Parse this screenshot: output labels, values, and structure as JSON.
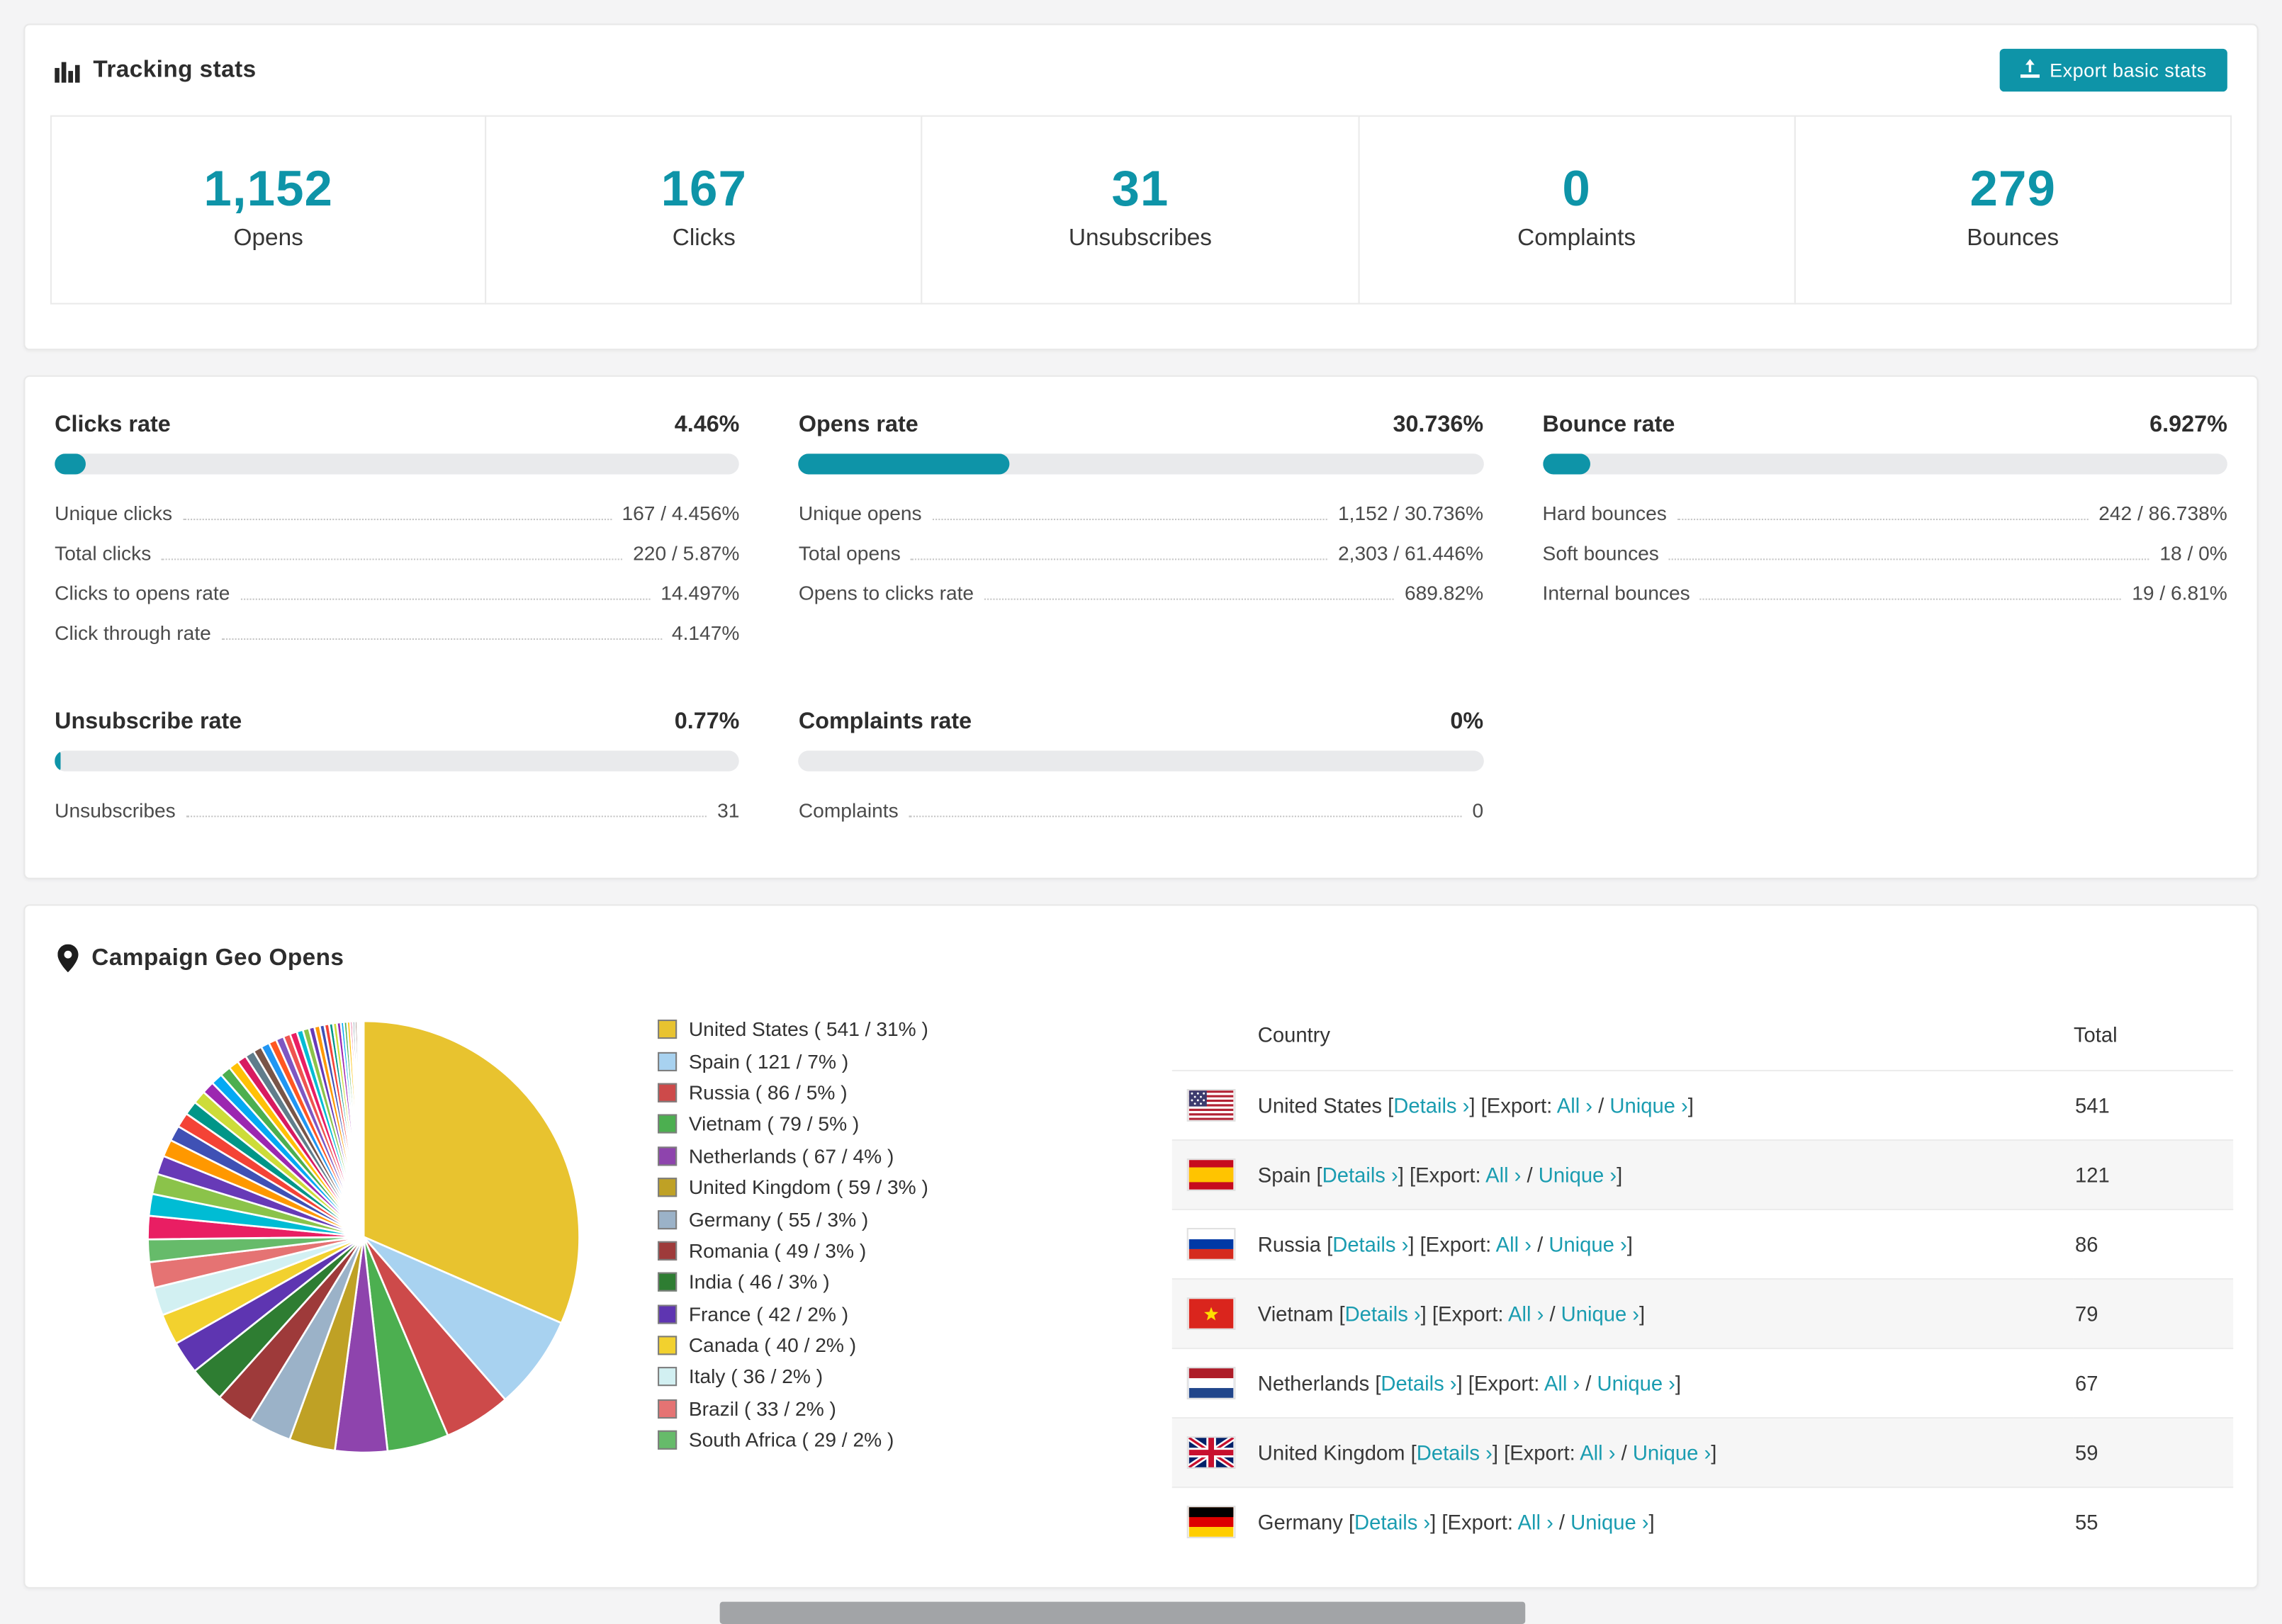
{
  "accent": "#0e94a8",
  "tracking": {
    "title": "Tracking stats",
    "export_button": "Export basic stats",
    "stats": [
      {
        "value": "1,152",
        "label": "Opens"
      },
      {
        "value": "167",
        "label": "Clicks"
      },
      {
        "value": "31",
        "label": "Unsubscribes"
      },
      {
        "value": "0",
        "label": "Complaints"
      },
      {
        "value": "279",
        "label": "Bounces"
      }
    ]
  },
  "rates": [
    {
      "title": "Clicks rate",
      "value": "4.46%",
      "percent": 4.46,
      "rows": [
        {
          "label": "Unique clicks",
          "value": "167 / 4.456%"
        },
        {
          "label": "Total clicks",
          "value": "220 / 5.87%"
        },
        {
          "label": "Clicks to opens rate",
          "value": "14.497%"
        },
        {
          "label": "Click through rate",
          "value": "4.147%"
        }
      ]
    },
    {
      "title": "Opens rate",
      "value": "30.736%",
      "percent": 30.736,
      "rows": [
        {
          "label": "Unique opens",
          "value": "1,152 / 30.736%"
        },
        {
          "label": "Total opens",
          "value": "2,303 / 61.446%"
        },
        {
          "label": "Opens to clicks rate",
          "value": "689.82%"
        }
      ]
    },
    {
      "title": "Bounce rate",
      "value": "6.927%",
      "percent": 6.927,
      "rows": [
        {
          "label": "Hard bounces",
          "value": "242 / 86.738%"
        },
        {
          "label": "Soft bounces",
          "value": "18 / 0%"
        },
        {
          "label": "Internal bounces",
          "value": "19 / 6.81%"
        }
      ]
    },
    {
      "title": "Unsubscribe rate",
      "value": "0.77%",
      "percent": 0.77,
      "rows": [
        {
          "label": "Unsubscribes",
          "value": "31"
        }
      ]
    },
    {
      "title": "Complaints rate",
      "value": "0%",
      "percent": 0,
      "rows": [
        {
          "label": "Complaints",
          "value": "0"
        }
      ]
    }
  ],
  "geo": {
    "title": "Campaign Geo Opens",
    "legend": [
      {
        "label": "United States ( 541 / 31% )",
        "color": "#e8c32f"
      },
      {
        "label": "Spain ( 121 / 7% )",
        "color": "#a8d2f0"
      },
      {
        "label": "Russia ( 86 / 5% )",
        "color": "#cd4a4a"
      },
      {
        "label": "Vietnam ( 79 / 5% )",
        "color": "#4caf50"
      },
      {
        "label": "Netherlands ( 67 / 4% )",
        "color": "#8e44ad"
      },
      {
        "label": "United Kingdom ( 59 / 3% )",
        "color": "#bfa125"
      },
      {
        "label": "Germany ( 55 / 3% )",
        "color": "#9bb2c8"
      },
      {
        "label": "Romania ( 49 / 3% )",
        "color": "#9e3a3a"
      },
      {
        "label": "India ( 46 / 3% )",
        "color": "#2e7d32"
      },
      {
        "label": "France ( 42 / 2% )",
        "color": "#5e35b1"
      },
      {
        "label": "Canada ( 40 / 2% )",
        "color": "#f2d12e"
      },
      {
        "label": "Italy ( 36 / 2% )",
        "color": "#d2f0f2"
      },
      {
        "label": "Brazil ( 33 / 2% )",
        "color": "#e57373"
      },
      {
        "label": "South Africa ( 29 / 2% )",
        "color": "#66bb6a"
      }
    ],
    "chart_data": {
      "type": "pie",
      "title": "Campaign Geo Opens",
      "unit": "opens",
      "slices": [
        {
          "label": "United States",
          "value": 541,
          "pct": 31,
          "color": "#e8c32f"
        },
        {
          "label": "Spain",
          "value": 121,
          "pct": 7,
          "color": "#a8d2f0"
        },
        {
          "label": "Russia",
          "value": 86,
          "pct": 5,
          "color": "#cd4a4a"
        },
        {
          "label": "Vietnam",
          "value": 79,
          "pct": 5,
          "color": "#4caf50"
        },
        {
          "label": "Netherlands",
          "value": 67,
          "pct": 4,
          "color": "#8e44ad"
        },
        {
          "label": "United Kingdom",
          "value": 59,
          "pct": 3,
          "color": "#bfa125"
        },
        {
          "label": "Germany",
          "value": 55,
          "pct": 3,
          "color": "#9bb2c8"
        },
        {
          "label": "Romania",
          "value": 49,
          "pct": 3,
          "color": "#9e3a3a"
        },
        {
          "label": "India",
          "value": 46,
          "pct": 3,
          "color": "#2e7d32"
        },
        {
          "label": "France",
          "value": 42,
          "pct": 2,
          "color": "#5e35b1"
        },
        {
          "label": "Canada",
          "value": 40,
          "pct": 2,
          "color": "#f2d12e"
        },
        {
          "label": "Italy",
          "value": 36,
          "pct": 2,
          "color": "#d2f0f2"
        },
        {
          "label": "Brazil",
          "value": 33,
          "pct": 2,
          "color": "#e57373"
        },
        {
          "label": "South Africa",
          "value": 29,
          "pct": 2,
          "color": "#66bb6a"
        }
      ],
      "others": {
        "values": [
          30,
          28,
          26,
          24,
          22,
          20,
          19,
          18,
          17,
          16,
          15,
          14,
          13,
          12,
          12,
          11,
          11,
          10,
          10,
          9,
          9,
          8,
          8,
          7,
          7,
          6,
          6,
          5,
          5,
          5,
          4,
          4,
          4,
          3,
          3,
          3,
          2,
          2,
          2,
          2
        ],
        "colors": [
          "#e91e63",
          "#00bcd4",
          "#8bc34a",
          "#673ab7",
          "#ff9800",
          "#3f51b5",
          "#f44336",
          "#009688",
          "#cddc39",
          "#9c27b0",
          "#03a9f4",
          "#4caf50",
          "#ffc107",
          "#d81b60",
          "#607d8b",
          "#795548",
          "#2196f3",
          "#ff5722",
          "#7e57c2",
          "#ef5350"
        ]
      }
    },
    "table": {
      "headers": [
        "Country",
        "Total"
      ],
      "punct_open": " [",
      "punct_mid": "] [",
      "export_label": "Export: ",
      "punct_slash": " / ",
      "punct_close": "]",
      "link_details": "Details ›",
      "link_all": "All ›",
      "link_unique": "Unique ›",
      "rows": [
        {
          "country": "United States",
          "flag": "us",
          "total": "541"
        },
        {
          "country": "Spain",
          "flag": "es",
          "total": "121"
        },
        {
          "country": "Russia",
          "flag": "ru",
          "total": "86"
        },
        {
          "country": "Vietnam",
          "flag": "vn",
          "total": "79"
        },
        {
          "country": "Netherlands",
          "flag": "nl",
          "total": "67"
        },
        {
          "country": "United Kingdom",
          "flag": "gb",
          "total": "59"
        },
        {
          "country": "Germany",
          "flag": "de",
          "total": "55"
        }
      ]
    }
  }
}
